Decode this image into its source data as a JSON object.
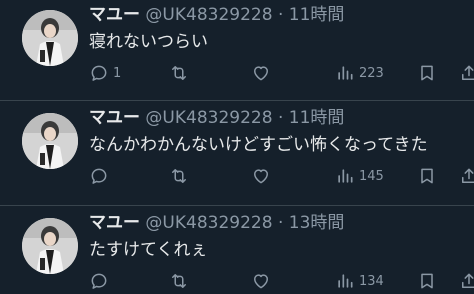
{
  "colors": {
    "background": "#15202b",
    "divider": "#38444d",
    "text_primary": "#e7e9ea",
    "text_secondary": "#8b98a5"
  },
  "tweets": [
    {
      "name": "マユー",
      "handle": "@UK48329228",
      "separator": "·",
      "time": "11時間",
      "text": "寝れないつらい",
      "replies": "1",
      "retweets": "",
      "likes": "",
      "views": "223",
      "avatar_icon": "avatar-photo"
    },
    {
      "name": "マユー",
      "handle": "@UK48329228",
      "separator": "·",
      "time": "11時間",
      "text": "なんかわかんないけどすごい怖くなってきた",
      "replies": "",
      "retweets": "",
      "likes": "",
      "views": "145",
      "avatar_icon": "avatar-photo"
    },
    {
      "name": "マユー",
      "handle": "@UK48329228",
      "separator": "·",
      "time": "13時間",
      "text": "たすけてくれぇ",
      "replies": "",
      "retweets": "",
      "likes": "",
      "views": "134",
      "avatar_icon": "avatar-photo"
    }
  ],
  "icons": {
    "reply": "reply-icon",
    "retweet": "retweet-icon",
    "like": "heart-icon",
    "views": "views-icon",
    "bookmark": "bookmark-icon",
    "share": "share-icon"
  }
}
